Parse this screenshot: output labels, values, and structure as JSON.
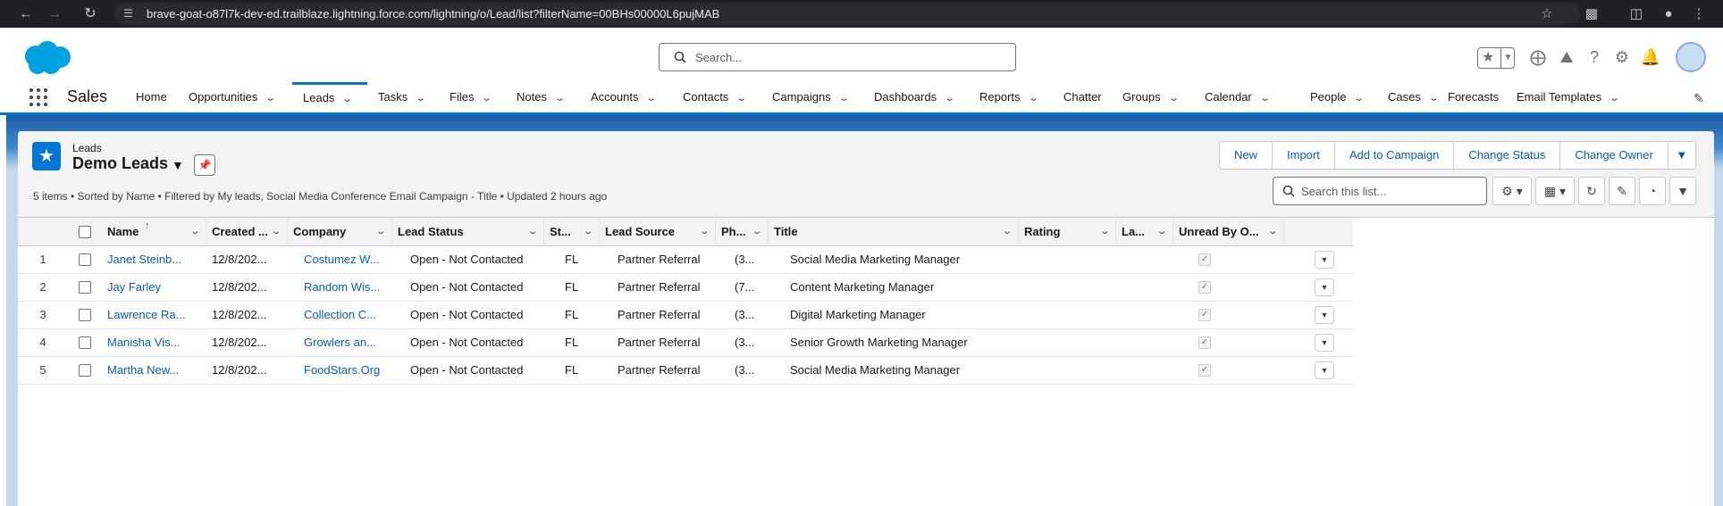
{
  "browser": {
    "url": "brave-goat-o87l7k-dev-ed.trailblaze.lightning.force.com/lightning/o/Lead/list?filterName=00BHs00000L6pujMAB"
  },
  "header": {
    "search_placeholder": "Search..."
  },
  "app": {
    "name": "Sales",
    "nav": [
      {
        "label": "Home",
        "dropdown": false
      },
      {
        "label": "Opportunities",
        "dropdown": true
      },
      {
        "label": "Leads",
        "dropdown": true,
        "active": true
      },
      {
        "label": "Tasks",
        "dropdown": true
      },
      {
        "label": "Files",
        "dropdown": true
      },
      {
        "label": "Notes",
        "dropdown": true
      },
      {
        "label": "Accounts",
        "dropdown": true
      },
      {
        "label": "Contacts",
        "dropdown": true
      },
      {
        "label": "Campaigns",
        "dropdown": true
      },
      {
        "label": "Dashboards",
        "dropdown": true
      },
      {
        "label": "Reports",
        "dropdown": true
      },
      {
        "label": "Chatter",
        "dropdown": false
      },
      {
        "label": "Groups",
        "dropdown": true
      },
      {
        "label": "Calendar",
        "dropdown": true
      },
      {
        "label": "People",
        "dropdown": true
      },
      {
        "label": "Cases",
        "dropdown": true
      },
      {
        "label": "Forecasts",
        "dropdown": false
      },
      {
        "label": "Email Templates",
        "dropdown": true
      }
    ]
  },
  "list_view": {
    "object_label": "Leads",
    "title": "Demo Leads",
    "meta": "5 items • Sorted by Name • Filtered by My leads, Social Media Conference Email Campaign - Title • Updated 2 hours ago",
    "actions": [
      "New",
      "Import",
      "Add to Campaign",
      "Change Status",
      "Change Owner"
    ],
    "search_placeholder": "Search this list...",
    "columns": [
      "Name",
      "Created ...",
      "Company",
      "Lead Status",
      "St...",
      "Lead Source",
      "Ph...",
      "Title",
      "Rating",
      "La...",
      "Unread By O..."
    ],
    "rows": [
      {
        "num": "1",
        "name": "Janet Steinb...",
        "created": "12/8/202...",
        "company": "Costumez W...",
        "status": "Open - Not Contacted",
        "state": "FL",
        "source": "Partner Referral",
        "phone": "(3...",
        "title": "Social Media Marketing Manager",
        "rating": "",
        "last": "",
        "unread": true
      },
      {
        "num": "2",
        "name": "Jay Farley",
        "created": "12/8/202...",
        "company": "Random Wis...",
        "status": "Open - Not Contacted",
        "state": "FL",
        "source": "Partner Referral",
        "phone": "(7...",
        "title": "Content Marketing Manager",
        "rating": "",
        "last": "",
        "unread": true
      },
      {
        "num": "3",
        "name": "Lawrence Ra...",
        "created": "12/8/202...",
        "company": "Collection C...",
        "status": "Open - Not Contacted",
        "state": "FL",
        "source": "Partner Referral",
        "phone": "(3...",
        "title": "Digital Marketing Manager",
        "rating": "",
        "last": "",
        "unread": true
      },
      {
        "num": "4",
        "name": "Manisha Vis...",
        "created": "12/8/202...",
        "company": "Growlers an...",
        "status": "Open - Not Contacted",
        "state": "FL",
        "source": "Partner Referral",
        "phone": "(3...",
        "title": "Senior Growth Marketing Manager",
        "rating": "",
        "last": "",
        "unread": true
      },
      {
        "num": "5",
        "name": "Martha New...",
        "created": "12/8/202...",
        "company": "FoodStars.Org",
        "status": "Open - Not Contacted",
        "state": "FL",
        "source": "Partner Referral",
        "phone": "(3...",
        "title": "Social Media Marketing Manager",
        "rating": "",
        "last": "",
        "unread": true
      }
    ]
  },
  "colors": {
    "brand": "#0176d3",
    "link": "#0b5cab",
    "browser_bar": "#202124"
  }
}
